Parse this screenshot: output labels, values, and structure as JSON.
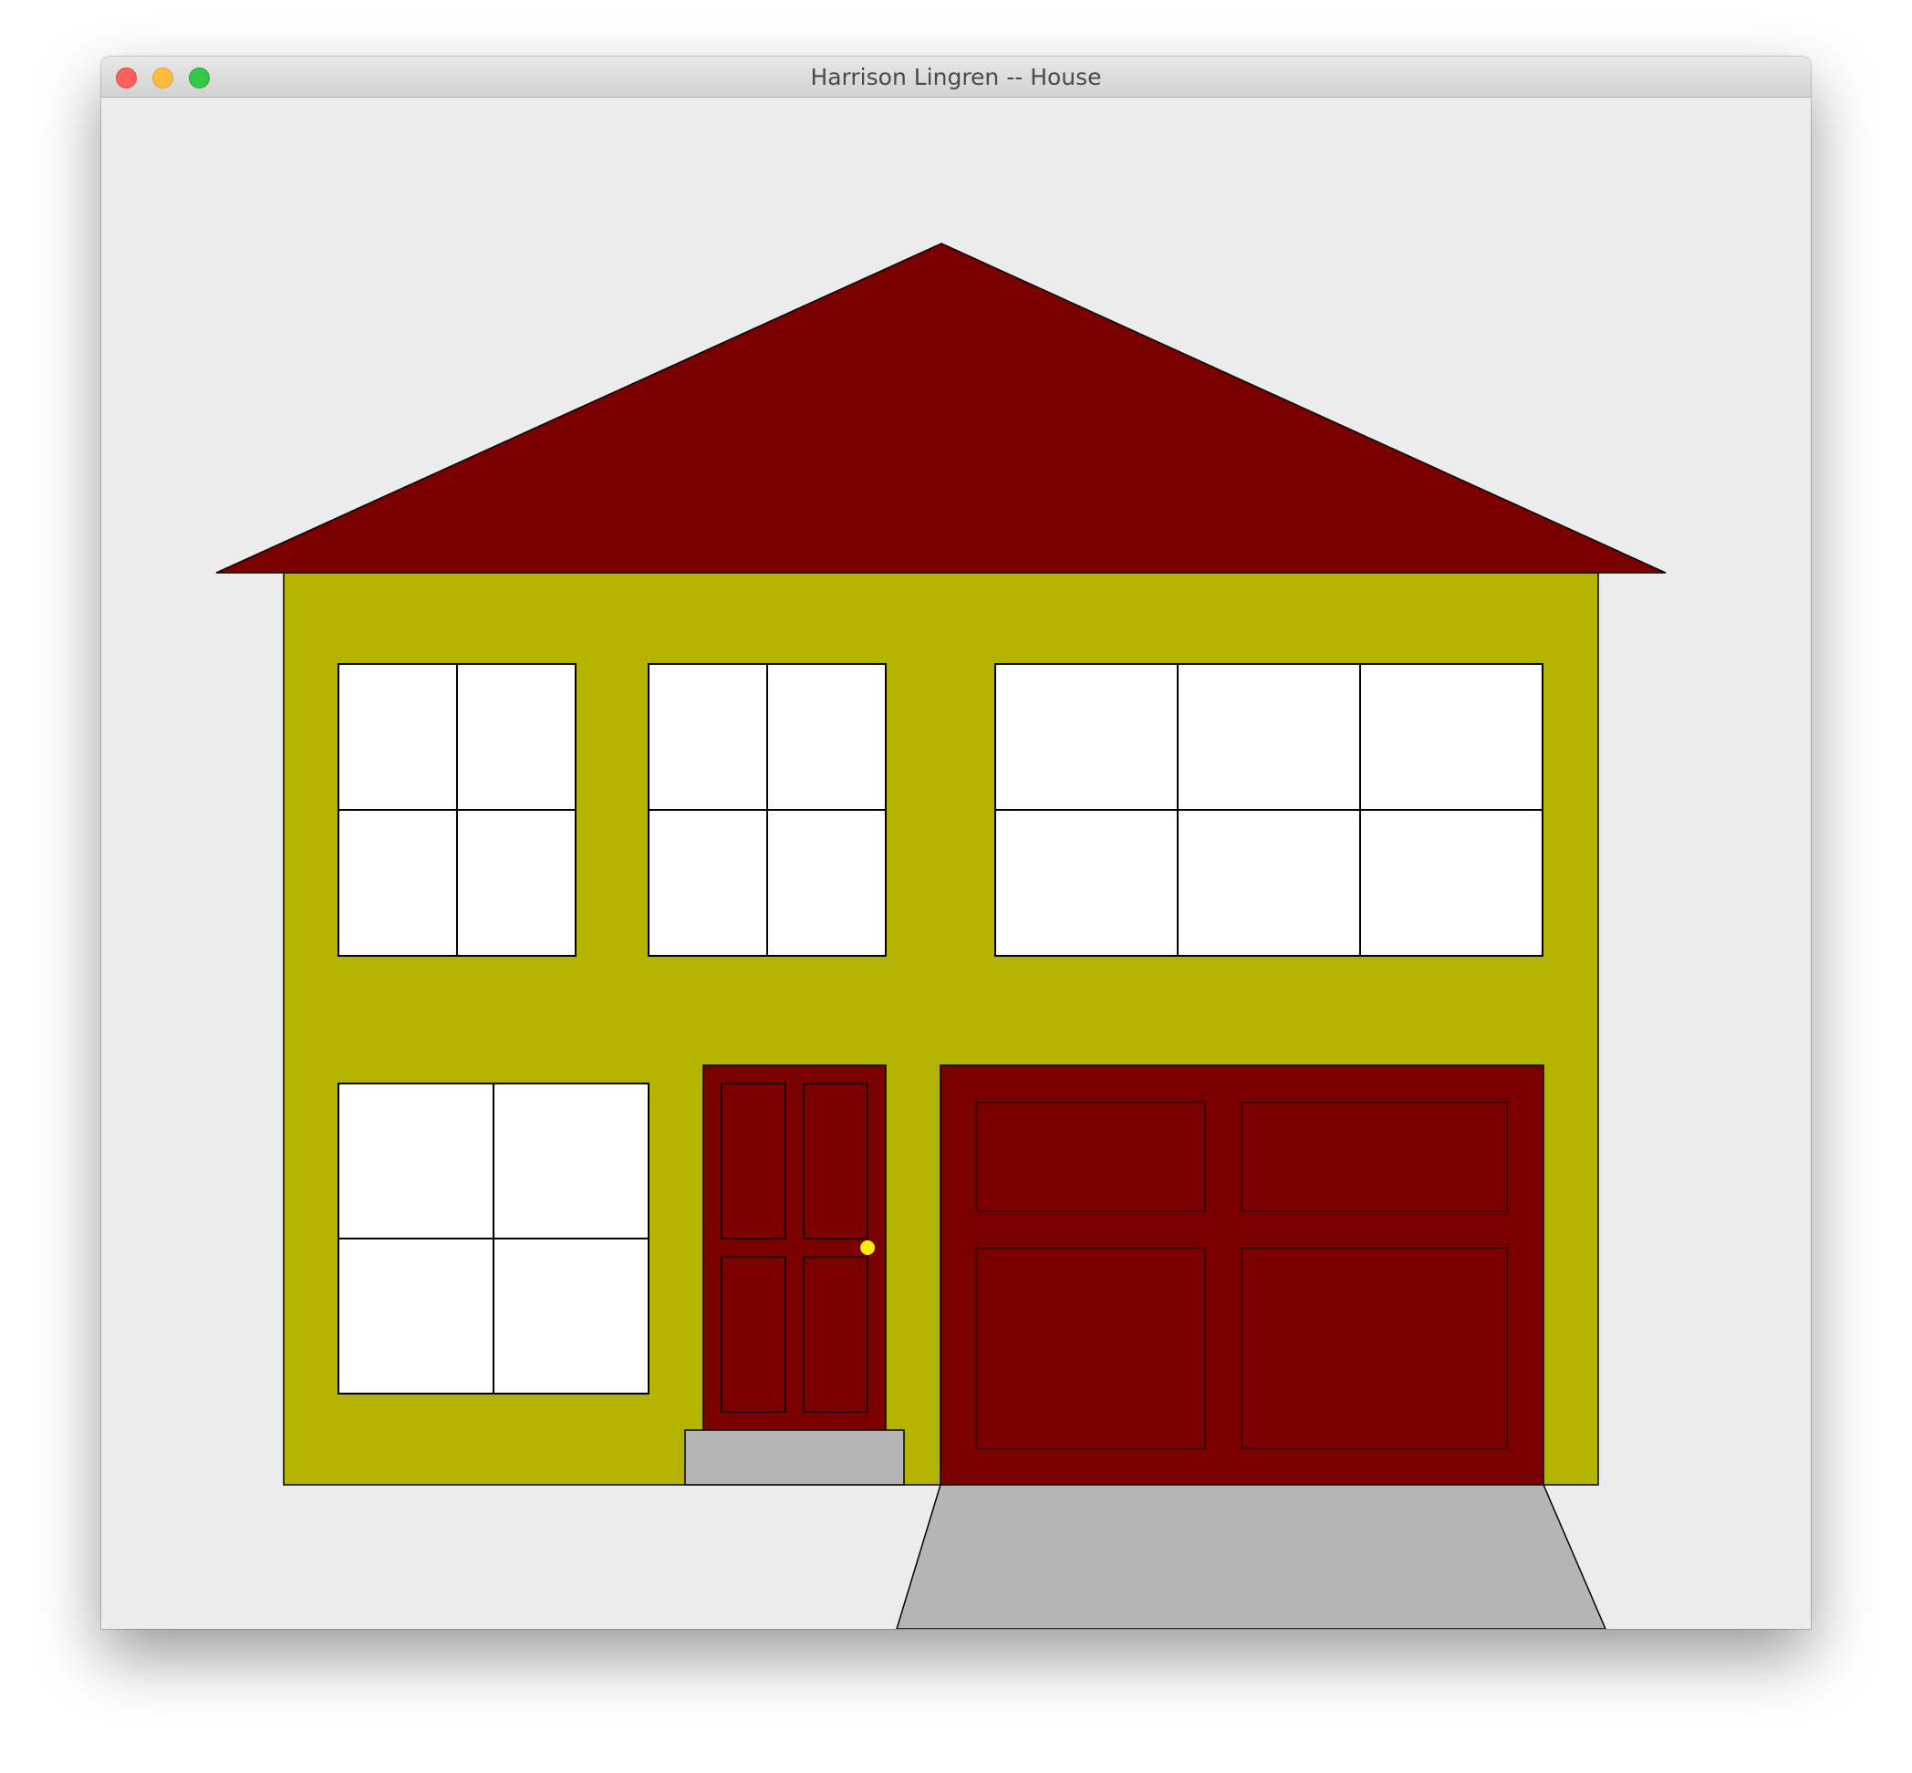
{
  "window": {
    "title": "Harrison Lingren -- House"
  },
  "colors": {
    "background": "#ececec",
    "roof": "#7a0000",
    "wall": "#b3b300",
    "window_glass": "#ffffff",
    "door": "#7a0000",
    "garage_door": "#7a0000",
    "doorknob": "#ffee00",
    "step": "#b5b5b5",
    "driveway": "#b5b5b5",
    "outline": "#000000"
  },
  "icons": {
    "close": "close-traffic-light-icon",
    "minimize": "minimize-traffic-light-icon",
    "zoom": "zoom-traffic-light-icon"
  }
}
